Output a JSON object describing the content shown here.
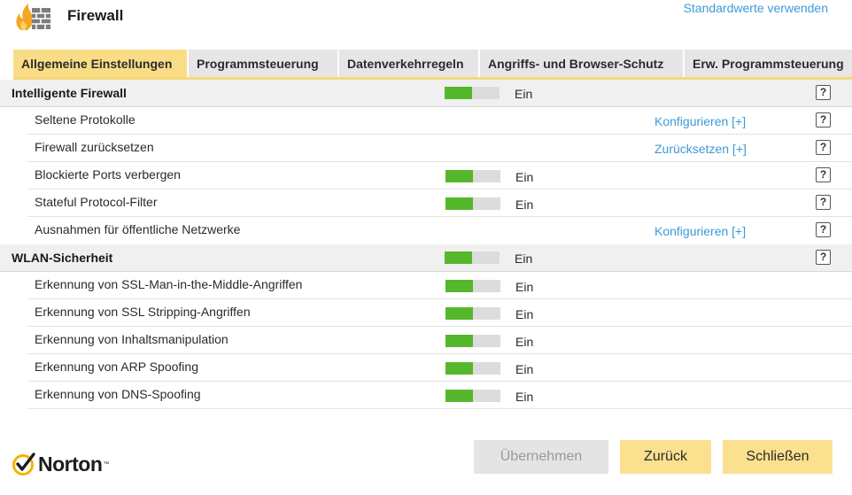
{
  "header": {
    "title": "Firewall",
    "defaults_link": "Standardwerte verwenden",
    "icon": "firewall-icon"
  },
  "tabs": [
    {
      "label": "Allgemeine Einstellungen",
      "active": true
    },
    {
      "label": "Programmsteuerung",
      "active": false
    },
    {
      "label": "Datenverkehrregeln",
      "active": false
    },
    {
      "label": "Angriffs- und Browser-Schutz",
      "active": false
    },
    {
      "label": "Erw. Programmsteuerung",
      "active": false
    }
  ],
  "sections": {
    "firewall": {
      "title": "Intelligente Firewall",
      "state": "Ein",
      "help": "?",
      "items": [
        {
          "label": "Seltene Protokolle",
          "link": "Konfigurieren [+]",
          "help": "?"
        },
        {
          "label": "Firewall zurücksetzen",
          "link": "Zurücksetzen [+]",
          "help": "?"
        },
        {
          "label": "Blockierte Ports verbergen",
          "state": "Ein",
          "help": "?"
        },
        {
          "label": "Stateful Protocol-Filter",
          "state": "Ein",
          "help": "?"
        },
        {
          "label": "Ausnahmen für öffentliche Netzwerke",
          "link": "Konfigurieren [+]",
          "help": "?"
        }
      ]
    },
    "wlan": {
      "title": "WLAN-Sicherheit",
      "state": "Ein",
      "help": "?",
      "items": [
        {
          "label": "Erkennung von SSL-Man-in-the-Middle-Angriffen",
          "state": "Ein"
        },
        {
          "label": "Erkennung von SSL Stripping-Angriffen",
          "state": "Ein"
        },
        {
          "label": "Erkennung von Inhaltsmanipulation",
          "state": "Ein"
        },
        {
          "label": "Erkennung von ARP Spoofing",
          "state": "Ein"
        },
        {
          "label": "Erkennung von DNS-Spoofing",
          "state": "Ein"
        }
      ]
    }
  },
  "toggle": {
    "on_fraction": 0.5,
    "on_color": "#55b72b",
    "off_color": "#dcdcdc"
  },
  "footer": {
    "logo_text": "Norton",
    "logo_tm": "™",
    "apply_label": "Übernehmen",
    "back_label": "Zurück",
    "close_label": "Schließen"
  },
  "colors": {
    "accent": "#f9dd86",
    "link": "#3b9bd6"
  }
}
